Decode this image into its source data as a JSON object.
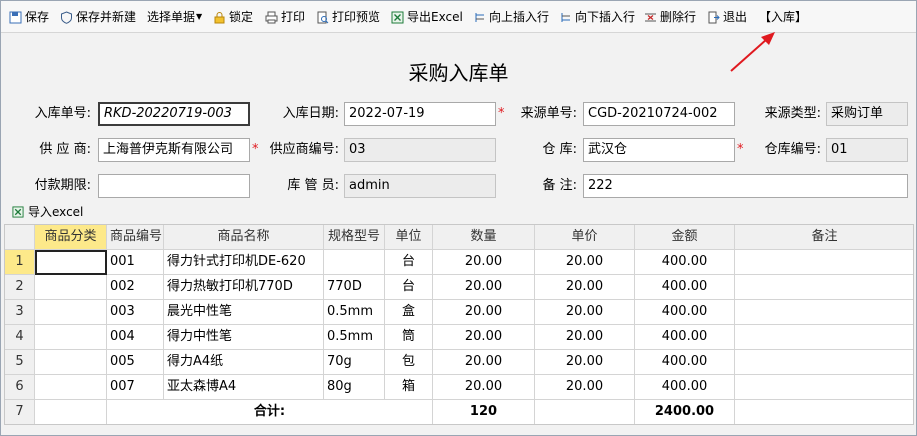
{
  "toolbar": {
    "items": [
      {
        "label": "保存"
      },
      {
        "label": "保存并新建"
      },
      {
        "label": "选择单据"
      },
      {
        "label": "锁定"
      },
      {
        "label": "打印"
      },
      {
        "label": "打印预览"
      },
      {
        "label": "导出Excel"
      },
      {
        "label": "向上插入行"
      },
      {
        "label": "向下插入行"
      },
      {
        "label": "删除行"
      },
      {
        "label": "退出"
      },
      {
        "label": "【入库】"
      }
    ]
  },
  "form": {
    "title": "采购入库单",
    "inbound_no": {
      "label": "入库单号:",
      "value": "RKD-20220719-003"
    },
    "inbound_date": {
      "label": "入库日期:",
      "value": "2022-07-19"
    },
    "source_no": {
      "label": "来源单号:",
      "value": "CGD-20210724-002"
    },
    "source_type": {
      "label": "来源类型:",
      "value": "采购订单"
    },
    "supplier": {
      "label": "供 应 商:",
      "value": "上海普伊克斯有限公司"
    },
    "supplier_code": {
      "label": "供应商编号:",
      "value": "03"
    },
    "warehouse": {
      "label": "仓 库:",
      "value": "武汉仓"
    },
    "warehouse_code": {
      "label": "仓库编号:",
      "value": "01"
    },
    "payment_term": {
      "label": "付款期限:",
      "value": ""
    },
    "keeper": {
      "label": "库 管 员:",
      "value": "admin"
    },
    "remark": {
      "label": "备 注:",
      "value": "222"
    },
    "required_mark": "*"
  },
  "import_excel": "导入excel",
  "table": {
    "columns": [
      "商品分类",
      "商品编号",
      "商品名称",
      "规格型号",
      "单位",
      "数量",
      "单价",
      "金额",
      "备注"
    ],
    "rows": [
      {
        "num": "1",
        "category": "",
        "code": "001",
        "name": "得力针式打印机DE-620",
        "spec": "",
        "unit": "台",
        "qty": "20.00",
        "price": "20.00",
        "amount": "400.00",
        "note": ""
      },
      {
        "num": "2",
        "category": "",
        "code": "002",
        "name": "得力热敏打印机770D",
        "spec": "770D",
        "unit": "台",
        "qty": "20.00",
        "price": "20.00",
        "amount": "400.00",
        "note": ""
      },
      {
        "num": "3",
        "category": "",
        "code": "003",
        "name": "晨光中性笔",
        "spec": "0.5mm",
        "unit": "盒",
        "qty": "20.00",
        "price": "20.00",
        "amount": "400.00",
        "note": ""
      },
      {
        "num": "4",
        "category": "",
        "code": "004",
        "name": "得力中性笔",
        "spec": "0.5mm",
        "unit": "筒",
        "qty": "20.00",
        "price": "20.00",
        "amount": "400.00",
        "note": ""
      },
      {
        "num": "5",
        "category": "",
        "code": "005",
        "name": "得力A4纸",
        "spec": "70g",
        "unit": "包",
        "qty": "20.00",
        "price": "20.00",
        "amount": "400.00",
        "note": ""
      },
      {
        "num": "6",
        "category": "",
        "code": "007",
        "name": "亚太森博A4",
        "spec": "80g",
        "unit": "箱",
        "qty": "20.00",
        "price": "20.00",
        "amount": "400.00",
        "note": ""
      }
    ],
    "total": {
      "num": "7",
      "label": "合计:",
      "qty": "120",
      "amount": "2400.00"
    }
  },
  "colors": {
    "accent": "#1f5fbf",
    "highlight": "#fde98a",
    "required": "#e0191f",
    "arrow": "#e0191f"
  }
}
